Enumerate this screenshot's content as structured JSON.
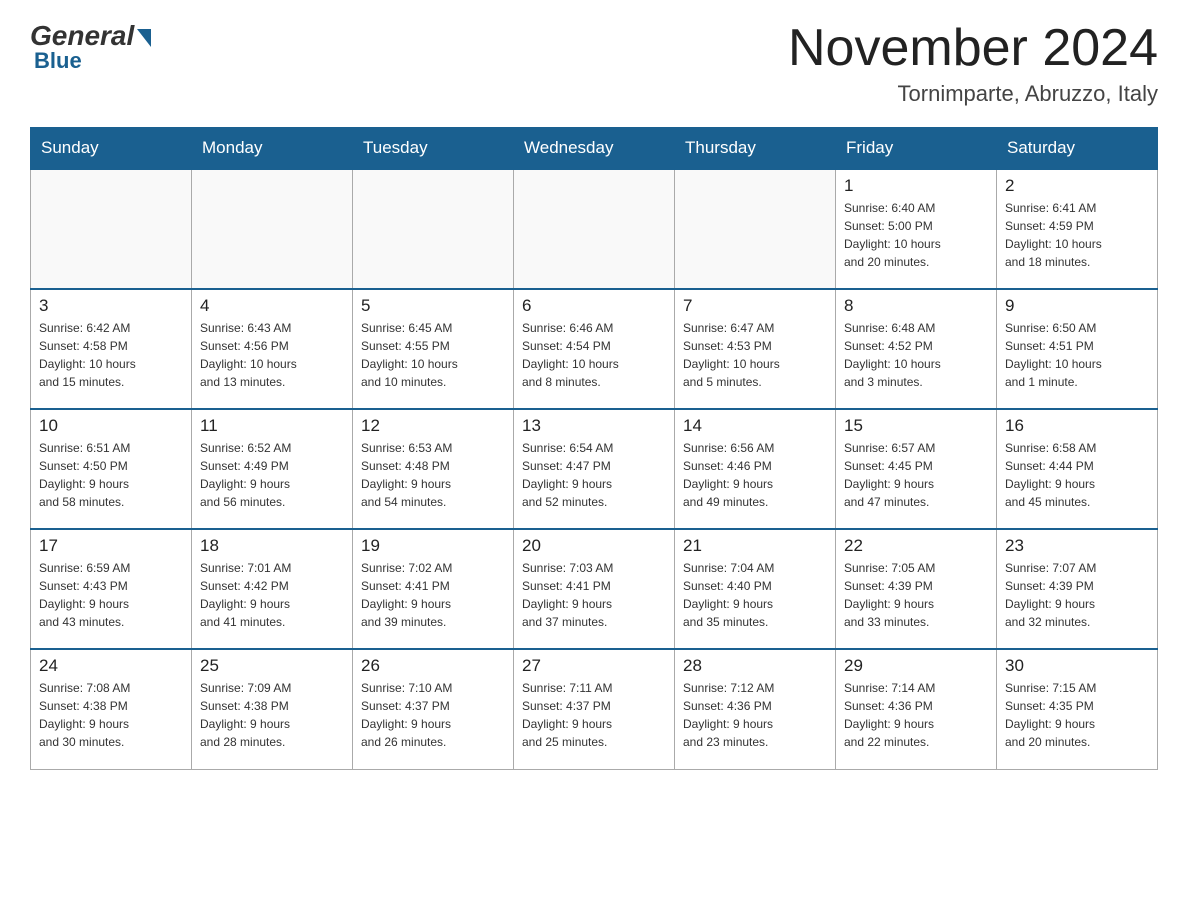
{
  "header": {
    "logo_general": "General",
    "logo_blue": "Blue",
    "month_title": "November 2024",
    "location": "Tornimparte, Abruzzo, Italy"
  },
  "days_of_week": [
    "Sunday",
    "Monday",
    "Tuesday",
    "Wednesday",
    "Thursday",
    "Friday",
    "Saturday"
  ],
  "weeks": [
    [
      {
        "day": "",
        "info": ""
      },
      {
        "day": "",
        "info": ""
      },
      {
        "day": "",
        "info": ""
      },
      {
        "day": "",
        "info": ""
      },
      {
        "day": "",
        "info": ""
      },
      {
        "day": "1",
        "info": "Sunrise: 6:40 AM\nSunset: 5:00 PM\nDaylight: 10 hours\nand 20 minutes."
      },
      {
        "day": "2",
        "info": "Sunrise: 6:41 AM\nSunset: 4:59 PM\nDaylight: 10 hours\nand 18 minutes."
      }
    ],
    [
      {
        "day": "3",
        "info": "Sunrise: 6:42 AM\nSunset: 4:58 PM\nDaylight: 10 hours\nand 15 minutes."
      },
      {
        "day": "4",
        "info": "Sunrise: 6:43 AM\nSunset: 4:56 PM\nDaylight: 10 hours\nand 13 minutes."
      },
      {
        "day": "5",
        "info": "Sunrise: 6:45 AM\nSunset: 4:55 PM\nDaylight: 10 hours\nand 10 minutes."
      },
      {
        "day": "6",
        "info": "Sunrise: 6:46 AM\nSunset: 4:54 PM\nDaylight: 10 hours\nand 8 minutes."
      },
      {
        "day": "7",
        "info": "Sunrise: 6:47 AM\nSunset: 4:53 PM\nDaylight: 10 hours\nand 5 minutes."
      },
      {
        "day": "8",
        "info": "Sunrise: 6:48 AM\nSunset: 4:52 PM\nDaylight: 10 hours\nand 3 minutes."
      },
      {
        "day": "9",
        "info": "Sunrise: 6:50 AM\nSunset: 4:51 PM\nDaylight: 10 hours\nand 1 minute."
      }
    ],
    [
      {
        "day": "10",
        "info": "Sunrise: 6:51 AM\nSunset: 4:50 PM\nDaylight: 9 hours\nand 58 minutes."
      },
      {
        "day": "11",
        "info": "Sunrise: 6:52 AM\nSunset: 4:49 PM\nDaylight: 9 hours\nand 56 minutes."
      },
      {
        "day": "12",
        "info": "Sunrise: 6:53 AM\nSunset: 4:48 PM\nDaylight: 9 hours\nand 54 minutes."
      },
      {
        "day": "13",
        "info": "Sunrise: 6:54 AM\nSunset: 4:47 PM\nDaylight: 9 hours\nand 52 minutes."
      },
      {
        "day": "14",
        "info": "Sunrise: 6:56 AM\nSunset: 4:46 PM\nDaylight: 9 hours\nand 49 minutes."
      },
      {
        "day": "15",
        "info": "Sunrise: 6:57 AM\nSunset: 4:45 PM\nDaylight: 9 hours\nand 47 minutes."
      },
      {
        "day": "16",
        "info": "Sunrise: 6:58 AM\nSunset: 4:44 PM\nDaylight: 9 hours\nand 45 minutes."
      }
    ],
    [
      {
        "day": "17",
        "info": "Sunrise: 6:59 AM\nSunset: 4:43 PM\nDaylight: 9 hours\nand 43 minutes."
      },
      {
        "day": "18",
        "info": "Sunrise: 7:01 AM\nSunset: 4:42 PM\nDaylight: 9 hours\nand 41 minutes."
      },
      {
        "day": "19",
        "info": "Sunrise: 7:02 AM\nSunset: 4:41 PM\nDaylight: 9 hours\nand 39 minutes."
      },
      {
        "day": "20",
        "info": "Sunrise: 7:03 AM\nSunset: 4:41 PM\nDaylight: 9 hours\nand 37 minutes."
      },
      {
        "day": "21",
        "info": "Sunrise: 7:04 AM\nSunset: 4:40 PM\nDaylight: 9 hours\nand 35 minutes."
      },
      {
        "day": "22",
        "info": "Sunrise: 7:05 AM\nSunset: 4:39 PM\nDaylight: 9 hours\nand 33 minutes."
      },
      {
        "day": "23",
        "info": "Sunrise: 7:07 AM\nSunset: 4:39 PM\nDaylight: 9 hours\nand 32 minutes."
      }
    ],
    [
      {
        "day": "24",
        "info": "Sunrise: 7:08 AM\nSunset: 4:38 PM\nDaylight: 9 hours\nand 30 minutes."
      },
      {
        "day": "25",
        "info": "Sunrise: 7:09 AM\nSunset: 4:38 PM\nDaylight: 9 hours\nand 28 minutes."
      },
      {
        "day": "26",
        "info": "Sunrise: 7:10 AM\nSunset: 4:37 PM\nDaylight: 9 hours\nand 26 minutes."
      },
      {
        "day": "27",
        "info": "Sunrise: 7:11 AM\nSunset: 4:37 PM\nDaylight: 9 hours\nand 25 minutes."
      },
      {
        "day": "28",
        "info": "Sunrise: 7:12 AM\nSunset: 4:36 PM\nDaylight: 9 hours\nand 23 minutes."
      },
      {
        "day": "29",
        "info": "Sunrise: 7:14 AM\nSunset: 4:36 PM\nDaylight: 9 hours\nand 22 minutes."
      },
      {
        "day": "30",
        "info": "Sunrise: 7:15 AM\nSunset: 4:35 PM\nDaylight: 9 hours\nand 20 minutes."
      }
    ]
  ]
}
